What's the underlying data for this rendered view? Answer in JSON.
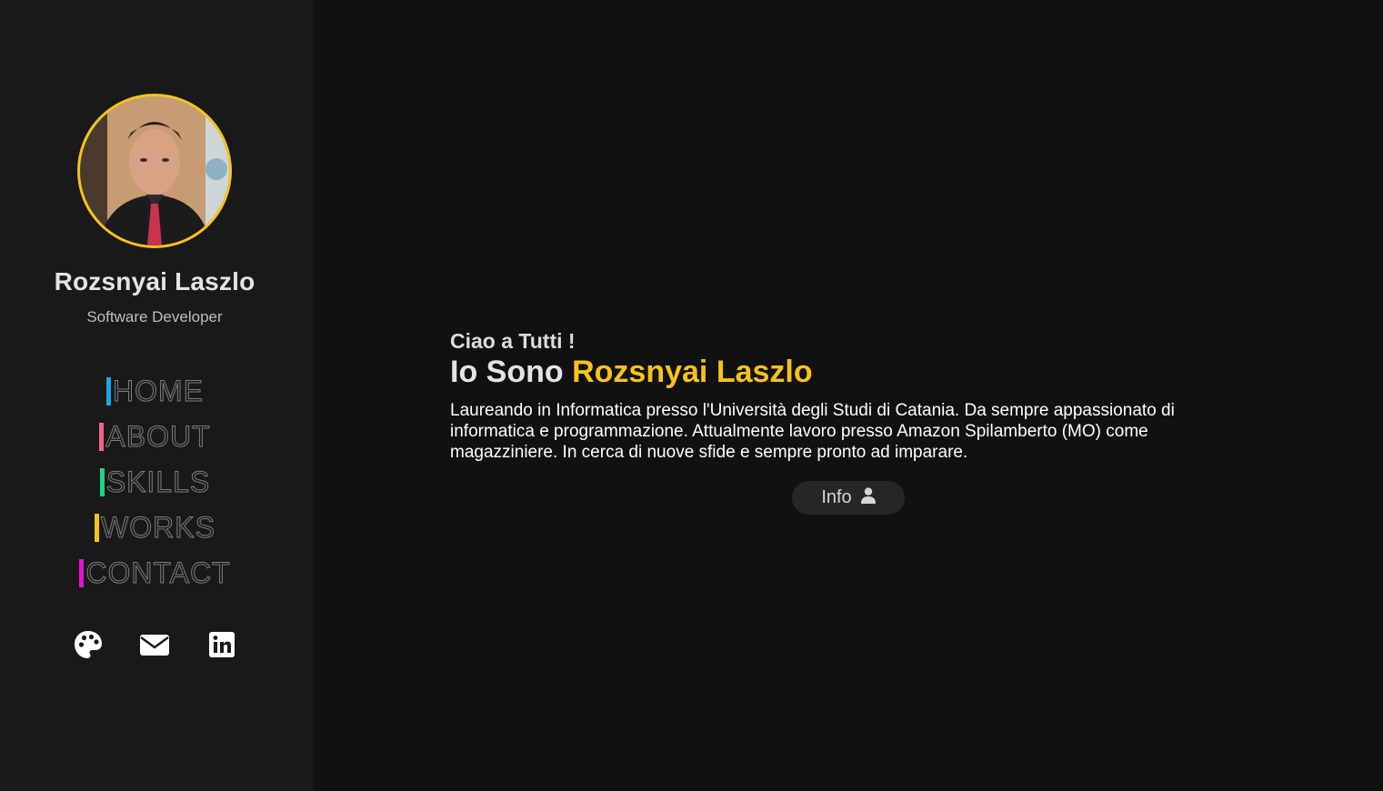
{
  "profile": {
    "name": "Rozsnyai Laszlo",
    "role": "Software Developer",
    "avatar_border_color": "#f7c21c"
  },
  "nav": {
    "items": [
      {
        "label": "HOME",
        "accent": "#1ba4e6"
      },
      {
        "label": "ABOUT",
        "accent": "#f2668b"
      },
      {
        "label": "SKILLS",
        "accent": "#1fd383"
      },
      {
        "label": "WORKS",
        "accent": "#f7c21c"
      },
      {
        "label": "CONTACT",
        "accent": "#e013d8"
      }
    ]
  },
  "social": {
    "icons": [
      "palette-icon",
      "envelope-icon",
      "linkedin-icon"
    ]
  },
  "hero": {
    "greeting": "Ciao a Tutti !",
    "headline_prefix": "Io Sono",
    "headline_name": "Rozsnyai Laszlo",
    "description": "Laureando in Informatica presso l'Università degli Studi di Catania. Da sempre appassionato di informatica e programmazione. Attualmente lavoro presso Amazon Spilamberto (MO) come magazziniere. In cerca di nuove sfide e sempre pronto ad imparare.",
    "info_button_label": "Info",
    "info_button_icon": "user-icon"
  },
  "colors": {
    "accent": "#f7c21c",
    "sidebar_bg": "#191919",
    "main_bg": "#111111"
  }
}
